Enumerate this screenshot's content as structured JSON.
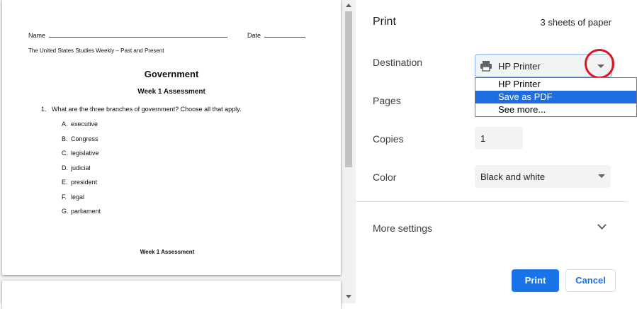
{
  "preview": {
    "name_label": "Name",
    "date_label": "Date",
    "header_line": "The United States Studies Weekly – Past and Present",
    "title": "Government",
    "subtitle": "Week 1 Assessment",
    "question": {
      "number": "1.",
      "text": "What are the three branches of government? Choose all that apply."
    },
    "options": [
      {
        "letter": "A.",
        "text": "executive"
      },
      {
        "letter": "B.",
        "text": "Congress"
      },
      {
        "letter": "C.",
        "text": "legislative"
      },
      {
        "letter": "D.",
        "text": "judicial"
      },
      {
        "letter": "E.",
        "text": "president"
      },
      {
        "letter": "F.",
        "text": "legal"
      },
      {
        "letter": "G.",
        "text": "parliament"
      }
    ],
    "footer": "Week 1 Assessment"
  },
  "panel": {
    "title": "Print",
    "sheets": "3 sheets of paper",
    "destination": {
      "label": "Destination",
      "value": "HP Printer",
      "options": [
        "HP Printer",
        "Save as PDF",
        "See more..."
      ],
      "selected_index": 1
    },
    "pages_label": "Pages",
    "copies": {
      "label": "Copies",
      "value": "1"
    },
    "color": {
      "label": "Color",
      "value": "Black and white"
    },
    "more_settings": "More settings",
    "print_button": "Print",
    "cancel_button": "Cancel"
  },
  "colors": {
    "accent": "#1a73e8",
    "highlight": "#e0141e"
  }
}
